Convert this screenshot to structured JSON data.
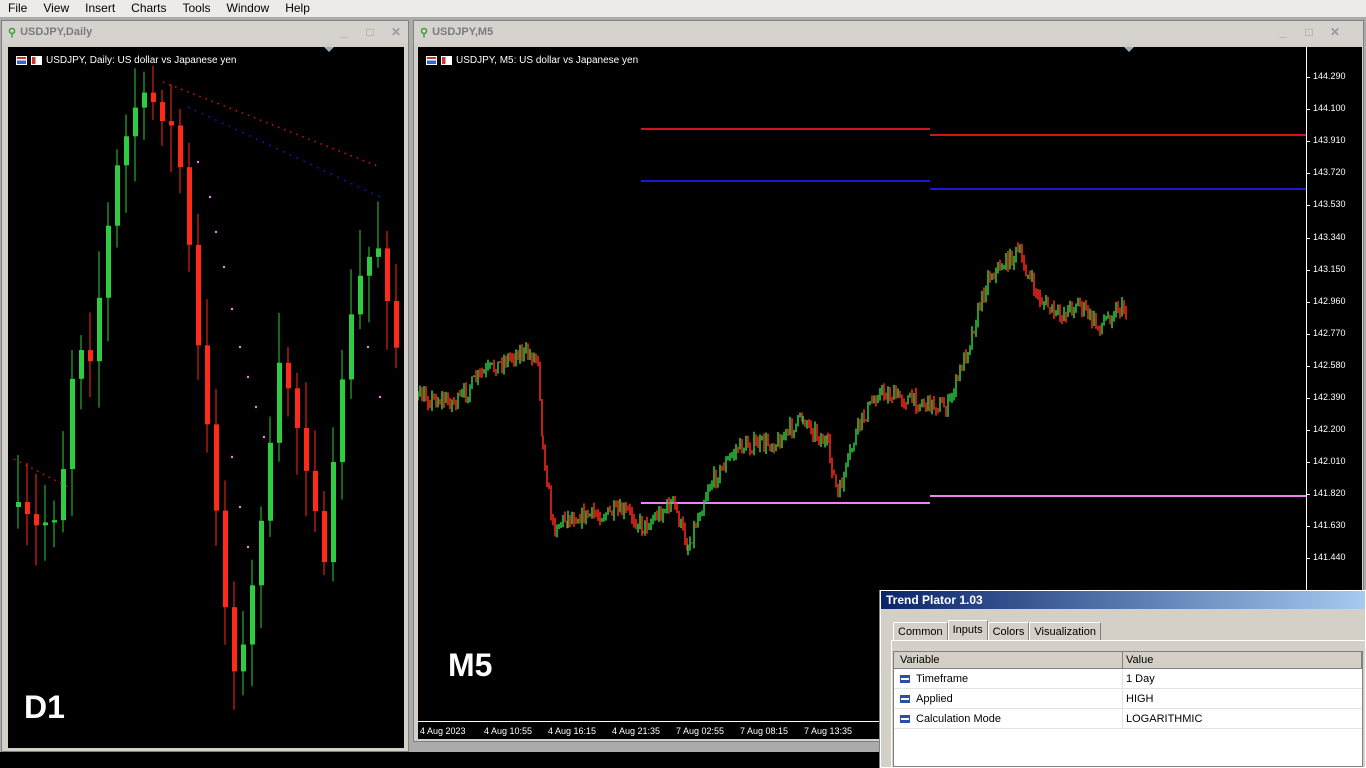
{
  "menu": [
    "File",
    "View",
    "Insert",
    "Charts",
    "Tools",
    "Window",
    "Help"
  ],
  "left_window": {
    "title": "USDJPY,Daily",
    "chart_label": "USDJPY, Daily:  US dollar vs Japanese yen",
    "timeframe_overlay": "D1"
  },
  "right_window": {
    "title": "USDJPY,M5",
    "chart_label": "USDJPY, M5:  US dollar vs Japanese yen",
    "timeframe_overlay": "M5",
    "price_ticks": [
      "144.290",
      "144.100",
      "143.910",
      "143.720",
      "143.530",
      "143.340",
      "143.150",
      "142.960",
      "142.770",
      "142.580",
      "142.390",
      "142.200",
      "142.010",
      "141.820",
      "141.630",
      "141.440"
    ],
    "time_ticks": [
      "4 Aug 2023",
      "4 Aug 10:55",
      "4 Aug 16:15",
      "4 Aug 21:35",
      "7 Aug 02:55",
      "7 Aug 08:15",
      "7 Aug 13:35"
    ]
  },
  "window_controls": {
    "minimize": "_",
    "maximize": "□",
    "close": "✕"
  },
  "dialog": {
    "title": "Trend Plator 1.03",
    "tabs": [
      "Common",
      "Inputs",
      "Colors",
      "Visualization"
    ],
    "active_tab": "Inputs",
    "columns": [
      "Variable",
      "Value"
    ],
    "rows": [
      {
        "variable": "Timeframe",
        "value": "1 Day"
      },
      {
        "variable": "Applied",
        "value": "HIGH"
      },
      {
        "variable": "Calculation Mode",
        "value": "LOGARITHMIC"
      }
    ]
  },
  "colors": {
    "up_candle": "#2ecc40",
    "down_candle": "#ff2a1a",
    "resistance_red": "#d21414",
    "resistance_blue": "#1a1ad2",
    "support_violet": "#ee82ee"
  }
}
